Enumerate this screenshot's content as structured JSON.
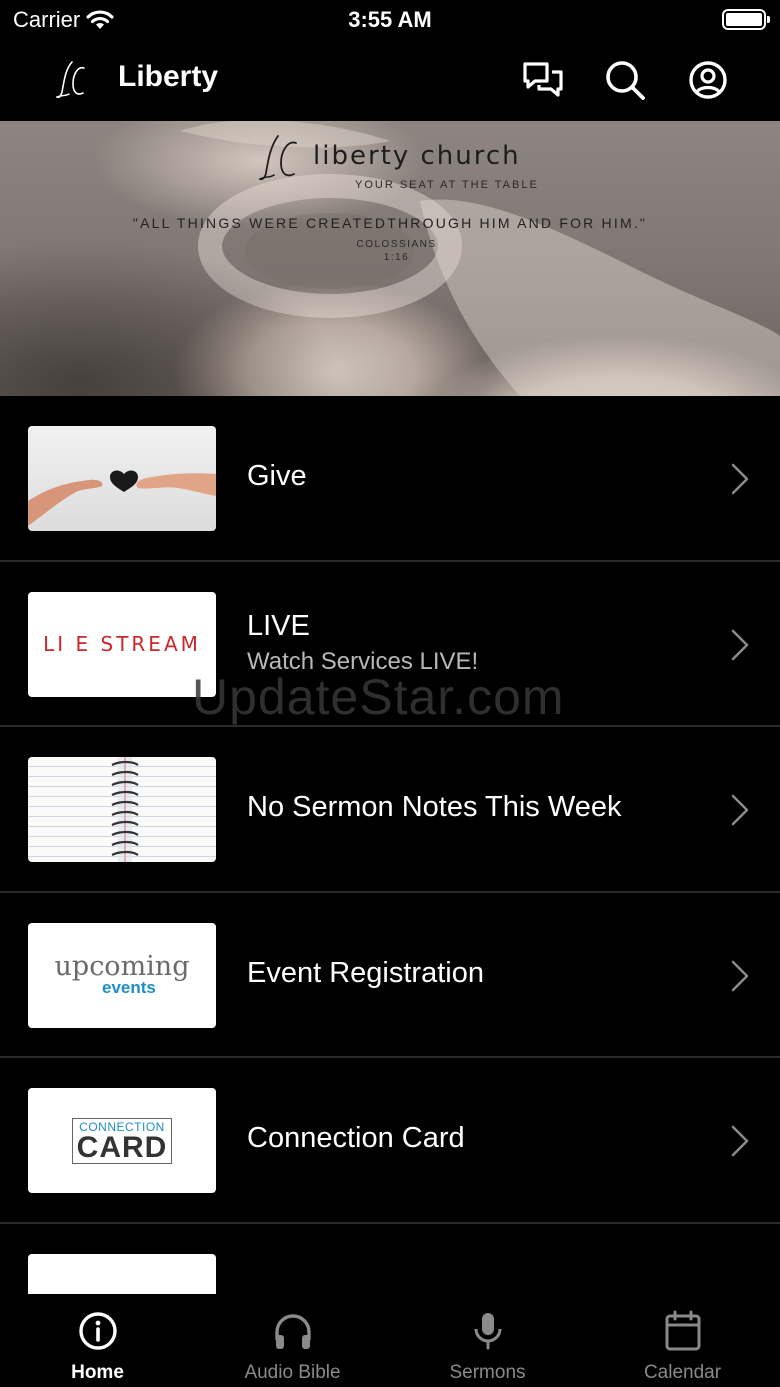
{
  "status_bar": {
    "carrier": "Carrier",
    "time": "3:55 AM",
    "icons": [
      "wifi-icon",
      "battery-icon"
    ]
  },
  "header": {
    "logo_text": "LC",
    "title": "Liberty",
    "actions": [
      "chat-icon",
      "search-icon",
      "profile-icon"
    ]
  },
  "hero": {
    "name": "liberty church",
    "tagline": "YOUR SEAT AT THE TABLE",
    "quote": "\"ALL THINGS WERE CREATEDTHROUGH HIM AND FOR HIM.\"",
    "reference_book": "COLOSSIANS",
    "reference_verse": "1:16"
  },
  "list": {
    "items": [
      {
        "title": "Give",
        "subtitle": "",
        "thumb": "hands-heart-image"
      },
      {
        "title": "LIVE",
        "subtitle": "Watch Services LIVE!",
        "thumb": "live-stream-image",
        "thumb_text": "LI E STREAM"
      },
      {
        "title": "No Sermon Notes This Week",
        "subtitle": "",
        "thumb": "notebook-image"
      },
      {
        "title": "Event Registration",
        "subtitle": "",
        "thumb": "upcoming-events-image",
        "thumb_text_1": "upcoming",
        "thumb_text_2": "events"
      },
      {
        "title": "Connection Card",
        "subtitle": "",
        "thumb": "connection-card-image",
        "thumb_text_1": "CONNECTION",
        "thumb_text_2": "CARD"
      },
      {
        "title": "",
        "subtitle": "",
        "thumb": "partial-image"
      }
    ]
  },
  "watermark": "UpdateStar.com",
  "tabbar": {
    "tabs": [
      {
        "label": "Home",
        "icon": "info-icon",
        "active": true
      },
      {
        "label": "Audio Bible",
        "icon": "headphones-icon",
        "active": false
      },
      {
        "label": "Sermons",
        "icon": "microphone-icon",
        "active": false
      },
      {
        "label": "Calendar",
        "icon": "calendar-icon",
        "active": false
      }
    ]
  },
  "colors": {
    "background": "#000000",
    "text": "#ffffff",
    "subtle": "#8a8a8a",
    "live_red": "#c62a2a",
    "events_blue": "#1d8ec6"
  }
}
